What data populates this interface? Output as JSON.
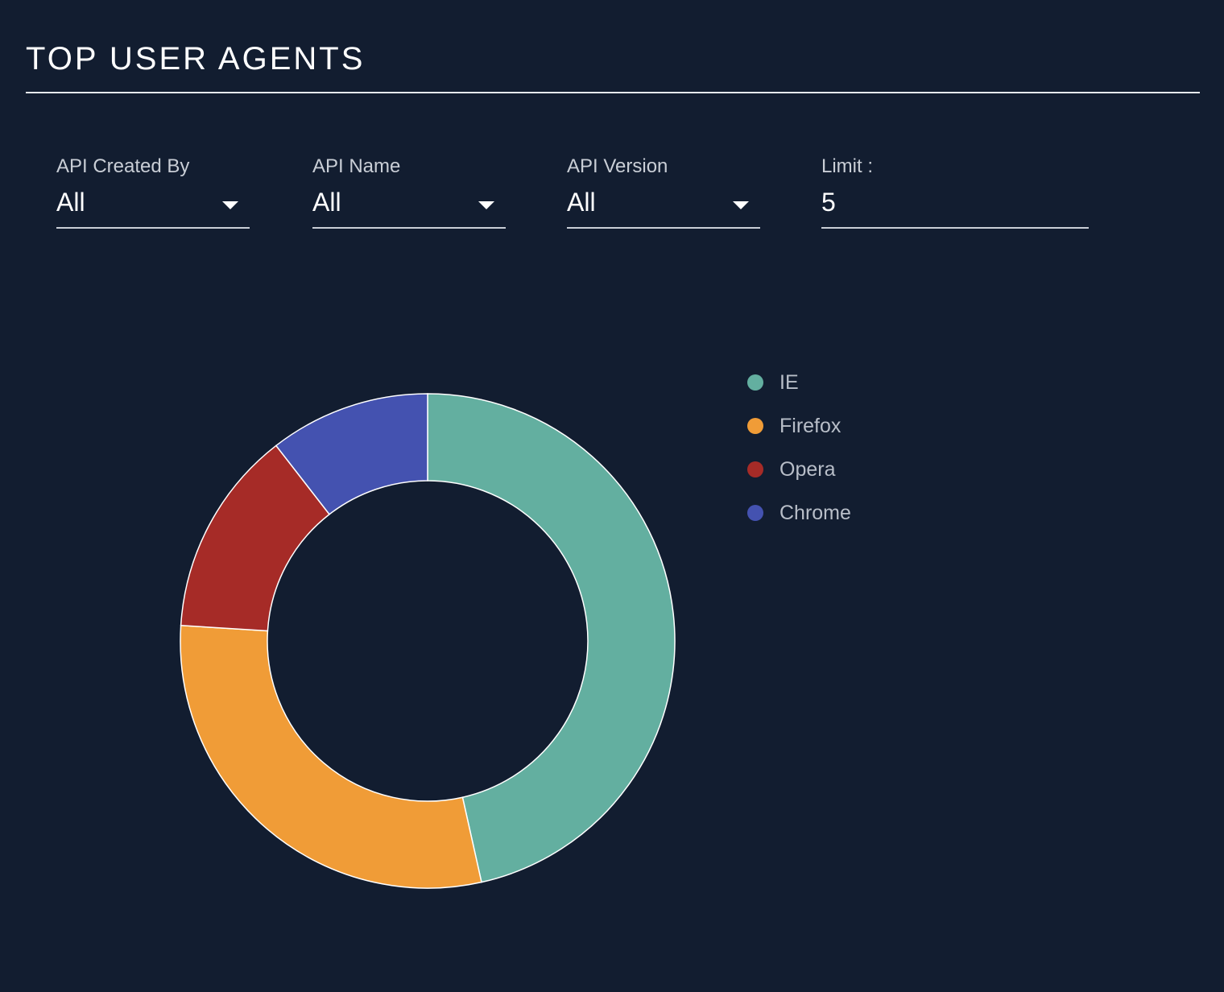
{
  "header": {
    "title": "TOP USER AGENTS"
  },
  "filters": {
    "created_by": {
      "label": "API Created By",
      "value": "All"
    },
    "api_name": {
      "label": "API Name",
      "value": "All"
    },
    "api_version": {
      "label": "API Version",
      "value": "All"
    },
    "limit": {
      "label": "Limit :",
      "value": "5"
    }
  },
  "icons": {
    "dropdown": "chevron-down-icon"
  },
  "colors": {
    "background": "#121d30",
    "ie": "#63afa0",
    "firefox": "#f09c37",
    "opera": "#a62b27",
    "chrome": "#4452b0"
  },
  "chart_data": {
    "type": "pie",
    "donut": true,
    "categories": [
      "IE",
      "Firefox",
      "Opera",
      "Chrome"
    ],
    "values": [
      46.5,
      29.5,
      13.5,
      10.5
    ],
    "colors": [
      "#63afa0",
      "#f09c37",
      "#a62b27",
      "#4452b0"
    ],
    "legend_position": "right",
    "title": ""
  }
}
